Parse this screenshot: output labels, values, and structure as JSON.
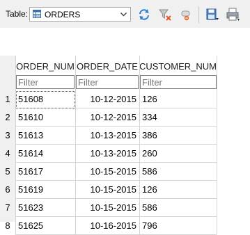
{
  "toolbar": {
    "table_label": "Table:",
    "table_selected": "ORDERS",
    "buttons": [
      "refresh-icon",
      "clear-filter-icon",
      "delete-record-icon",
      "save-icon",
      "print-icon"
    ]
  },
  "grid": {
    "columns": [
      "ORDER_NUM",
      "ORDER_DATE",
      "CUSTOMER_NUM"
    ],
    "filter_placeholder": "Filter",
    "rows": [
      {
        "n": "1",
        "order_num": "51608",
        "order_date": "10-12-2015",
        "customer_num": "126"
      },
      {
        "n": "2",
        "order_num": "51610",
        "order_date": "10-12-2015",
        "customer_num": "334"
      },
      {
        "n": "3",
        "order_num": "51613",
        "order_date": "10-13-2015",
        "customer_num": "386"
      },
      {
        "n": "4",
        "order_num": "51614",
        "order_date": "10-13-2015",
        "customer_num": "260"
      },
      {
        "n": "5",
        "order_num": "51617",
        "order_date": "10-15-2015",
        "customer_num": "586"
      },
      {
        "n": "6",
        "order_num": "51619",
        "order_date": "10-15-2015",
        "customer_num": "126"
      },
      {
        "n": "7",
        "order_num": "51623",
        "order_date": "10-15-2015",
        "customer_num": "586"
      },
      {
        "n": "8",
        "order_num": "51625",
        "order_date": "10-16-2015",
        "customer_num": "796"
      }
    ]
  }
}
